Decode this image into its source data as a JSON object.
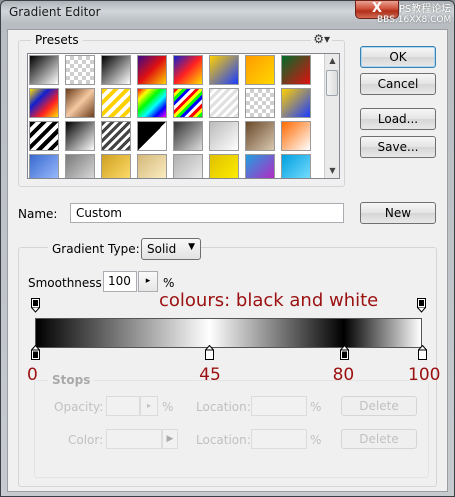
{
  "window": {
    "title": "Gradient Editor",
    "close_label": "X",
    "watermark_line1": "PS教程论坛",
    "watermark_line2": "BBS.16XX8.COM"
  },
  "presets": {
    "label": "Presets",
    "menu_icon": "gear-icon"
  },
  "buttons": {
    "ok": "OK",
    "cancel": "Cancel",
    "load": "Load...",
    "save": "Save...",
    "new": "New",
    "delete_opacity": "Delete",
    "delete_color": "Delete"
  },
  "name": {
    "label": "Name:",
    "value": "Custom"
  },
  "gradient_type": {
    "label": "Gradient Type:",
    "value": "Solid"
  },
  "smoothness": {
    "label": "Smoothness:",
    "value": "100",
    "unit": "%"
  },
  "gradient": {
    "stops": [
      {
        "position_percent": 0,
        "color": "#000000"
      },
      {
        "position_percent": 45,
        "color": "#ffffff"
      },
      {
        "position_percent": 80,
        "color": "#000000"
      },
      {
        "position_percent": 100,
        "color": "#ffffff"
      }
    ]
  },
  "annotations": {
    "caption": "colours: black and white",
    "stop_labels": [
      "0",
      "45",
      "80",
      "100"
    ],
    "color": "#9b1010"
  },
  "stops_section": {
    "label": "Stops",
    "opacity_label": "Opacity:",
    "opacity_unit": "%",
    "location_label_1": "Location:",
    "location_unit_1": "%",
    "color_label": "Color:",
    "location_label_2": "Location:",
    "location_unit_2": "%"
  }
}
